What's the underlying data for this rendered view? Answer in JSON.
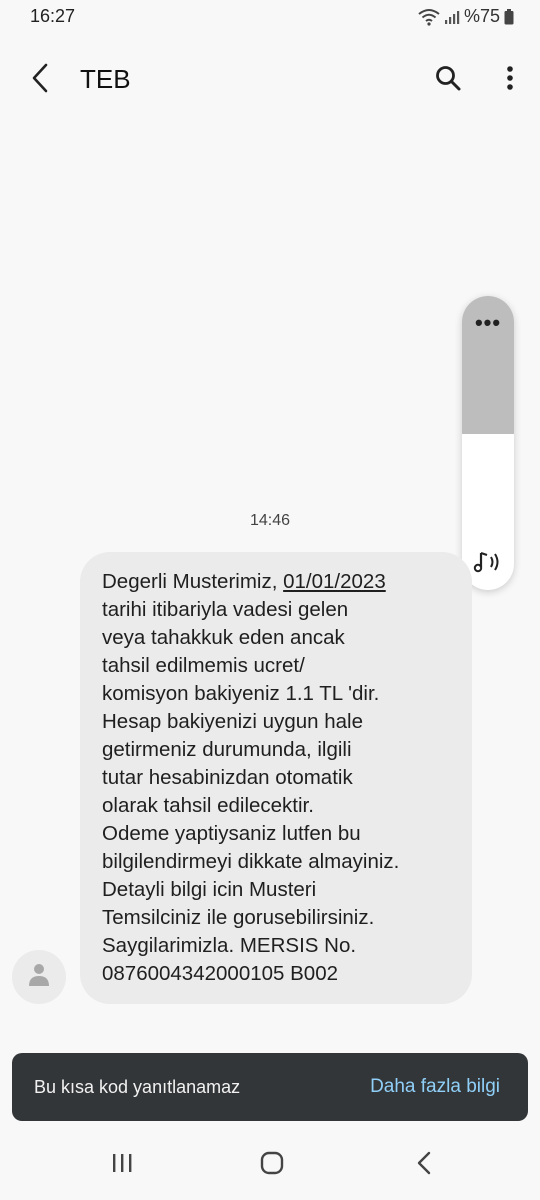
{
  "status_bar": {
    "time": "16:27",
    "battery_text": "%75",
    "icons": [
      "wifi-icon",
      "signal-icon",
      "battery-icon"
    ]
  },
  "header": {
    "title": "TEB",
    "back_icon": "chevron-left-icon",
    "search_icon": "search-icon",
    "more_icon": "more-vertical-icon"
  },
  "edge_panel": {
    "dots": "•••",
    "sound_icon": "sound-icon",
    "level": 0.47
  },
  "conversation": {
    "timestamp": "14:46",
    "message": {
      "prefix": "Degerli Musterimiz, ",
      "date_link": "01/01/2023",
      "body": "\ntarihi itibariyla vadesi gelen\nveya tahakkuk eden ancak\ntahsil edilmemis ucret/\nkomisyon bakiyeniz 1.1 TL 'dir.\nHesap bakiyenizi uygun hale\ngetirmeniz durumunda, ilgili\ntutar hesabinizdan otomatik\nolarak tahsil edilecektir.\nOdeme yaptiysaniz lutfen bu\nbilgilendirmeyi dikkate almayiniz.\nDetayli bilgi icin Musteri\nTemsilciniz ile gorusebilirsiniz.\nSaygilarimizla. MERSIS No.\n0876004342000105 B002"
    },
    "avatar_icon": "person-icon"
  },
  "snackbar": {
    "message": "Bu kısa kod yanıtlanamaz",
    "action": "Daha fazla bilgi"
  },
  "navbar": {
    "recents_icon": "recents-icon",
    "home_icon": "home-icon",
    "back_icon": "back-icon"
  },
  "colors": {
    "background": "#f8f8f8",
    "bubble": "#ebebeb",
    "snackbar": "#333638",
    "snackbar_action": "#8fcff8",
    "edge_top": "#bdbdbd"
  }
}
